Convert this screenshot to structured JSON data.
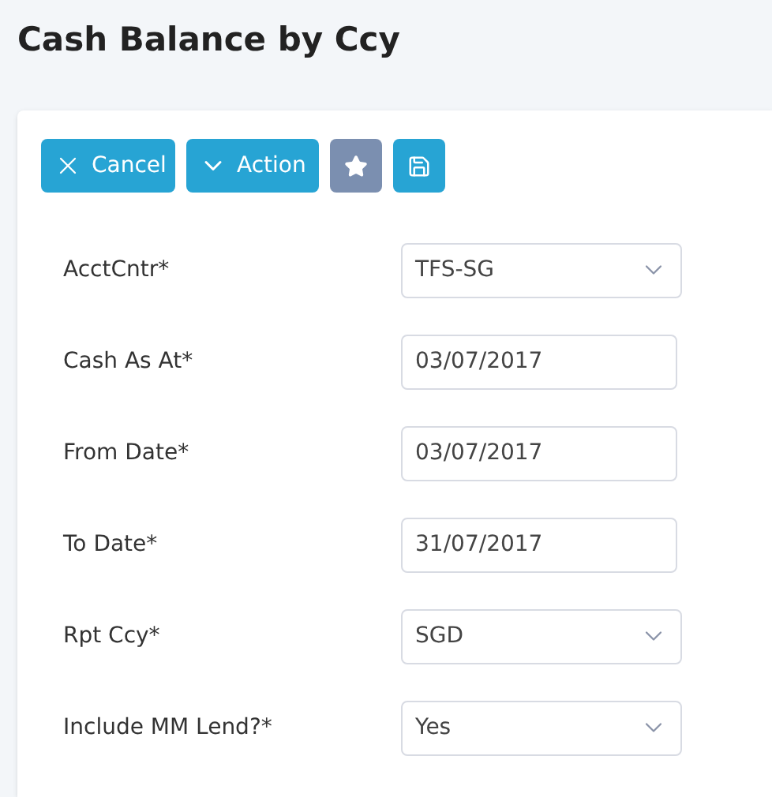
{
  "title": "Cash Balance by Ccy",
  "toolbar": [
    {
      "kind": "cancel",
      "label": "Cancel"
    },
    {
      "kind": "action",
      "label": "Action"
    },
    {
      "kind": "favorite"
    },
    {
      "kind": "save"
    }
  ],
  "fields": [
    {
      "label": "AcctCntr*",
      "kind": "select",
      "value": "TFS-SG"
    },
    {
      "label": "Cash As At*",
      "kind": "date",
      "value": "03/07/2017"
    },
    {
      "label": "From Date*",
      "kind": "date",
      "value": "03/07/2017"
    },
    {
      "label": "To Date*",
      "kind": "date",
      "value": "31/07/2017"
    },
    {
      "label": "Rpt Ccy*",
      "kind": "select",
      "value": "SGD"
    },
    {
      "label": "Include MM Lend?*",
      "kind": "select",
      "value": "Yes"
    }
  ]
}
